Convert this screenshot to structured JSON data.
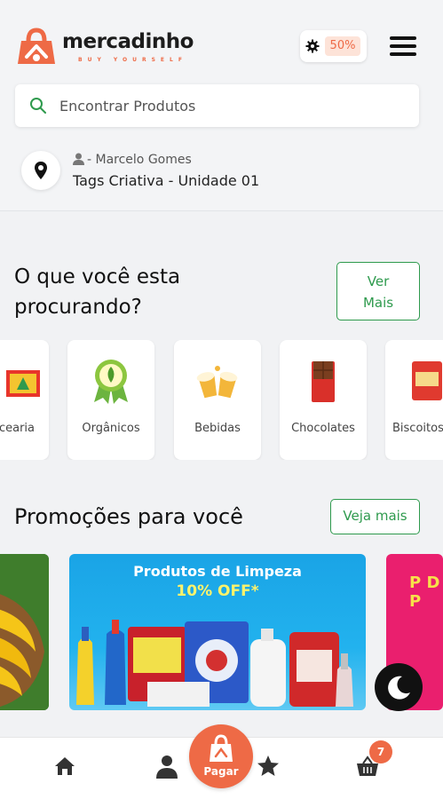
{
  "brand": {
    "name": "mercadinho",
    "tagline": "BUY YOURSELF"
  },
  "header": {
    "level_percent": "50%"
  },
  "search": {
    "placeholder": "Encontrar Produtos"
  },
  "location": {
    "user": "- Marcelo Gomes",
    "store": "Tags Criativa - Unidade 01"
  },
  "categories_section": {
    "title_line1": "O que você esta",
    "title_line2": "procurando?",
    "more_line1": "Ver",
    "more_line2": "Mais",
    "items": [
      {
        "label": "Mercearia"
      },
      {
        "label": "Orgânicos"
      },
      {
        "label": "Bebidas"
      },
      {
        "label": "Chocolates"
      },
      {
        "label": "Biscoitos"
      }
    ]
  },
  "promos_section": {
    "title": "Promoções para você",
    "more": "Veja mais",
    "banner": {
      "title": "Produtos de Limpeza",
      "subtitle": "10% OFF*"
    },
    "next_banner_letters": "P D P"
  },
  "bottom_nav": {
    "pay_label": "Pagar",
    "cart_count": "7"
  },
  "colors": {
    "accent": "#ee6a46",
    "green": "#2e9a4d",
    "background": "#f1f2f4"
  }
}
